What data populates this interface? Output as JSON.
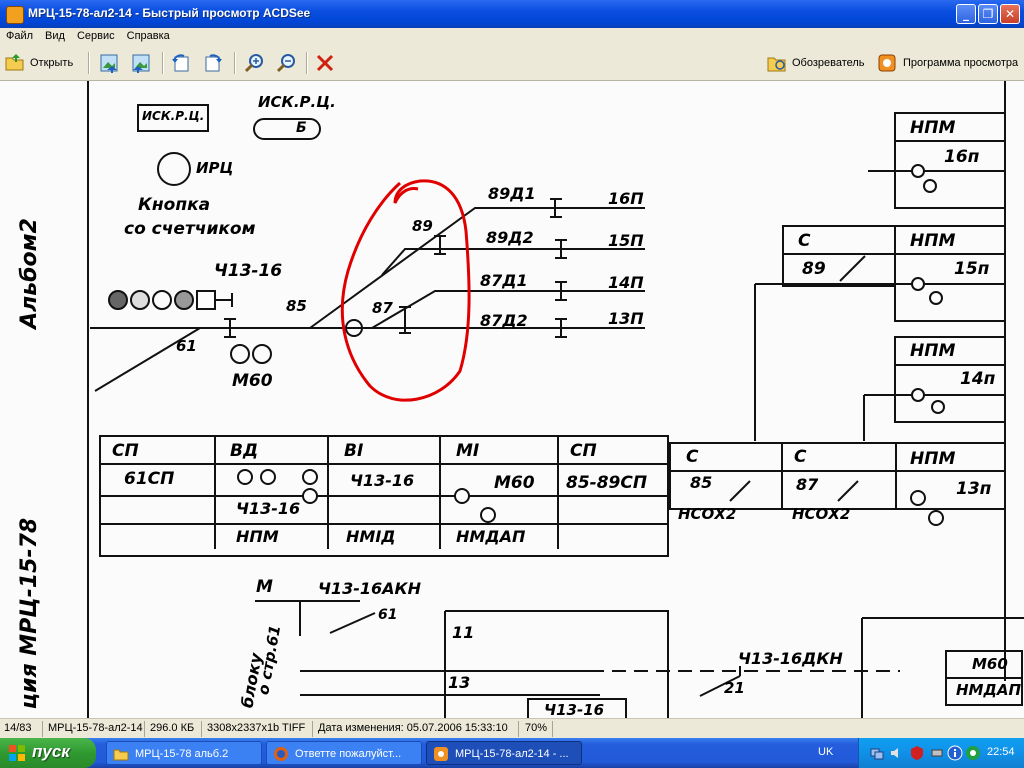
{
  "window": {
    "title": "МРЦ-15-78-ал2-14 - Быстрый просмотр ACDSee",
    "minimize": "_",
    "restore": "❐",
    "close": "✕"
  },
  "menu": [
    "Файл",
    "Вид",
    "Сервис",
    "Справка"
  ],
  "toolbar": {
    "open_label": "Открыть",
    "explorer_label": "Обозреватель",
    "viewer_label": "Программа просмотра"
  },
  "document": {
    "side_text_top": "Альбом2",
    "side_text_bottom": "ция МРЦ-15-78",
    "legend": {
      "isk_box": "ИСК.Р.Ц.",
      "isk_label": "ИСК.Р.Ц.",
      "isk_value": "Б",
      "irc": "ИРЦ",
      "knopka_1": "Кнопка",
      "knopka_2": "со счетчиком"
    },
    "track": {
      "signal_ch": "Ч13-16",
      "sw_85": "85",
      "sw_61": "61",
      "sw_89": "89",
      "sw_87": "87",
      "m60": "М60",
      "routes": [
        {
          "name": "89Д1",
          "track": "16П"
        },
        {
          "name": "89Д2",
          "track": "15П"
        },
        {
          "name": "87Д1",
          "track": "14П"
        },
        {
          "name": "87Д2",
          "track": "13П"
        }
      ]
    },
    "right_blocks": {
      "npm": "НПМ",
      "c": "С",
      "c89": "89",
      "t16": "16п",
      "t15": "15п",
      "t14": "14п",
      "t13": "13п"
    },
    "table": {
      "c1": [
        "СП",
        "61СП",
        ""
      ],
      "c2": [
        "ВД",
        "Ч13-16",
        "НПМ"
      ],
      "c3": [
        "ВI",
        "Ч13-16",
        "НМIД"
      ],
      "c4": [
        "МI",
        "М60",
        "НМДАП"
      ],
      "c5": [
        "СП",
        "85-89СП",
        ""
      ],
      "c6": [
        "С",
        "85",
        "НСОХ2"
      ],
      "c7": [
        "С",
        "87",
        "НСОХ2"
      ]
    },
    "bottom": {
      "m": "М",
      "akn": "Ч13-16АКН",
      "n61": "61",
      "n11": "11",
      "n13": "13",
      "box_ch": "Ч13-16",
      "dkn": "Ч13-16ДКН",
      "n21": "21",
      "blok_1": "блоку",
      "blok_2": "о стр.61",
      "m60": "М60",
      "nmdap": "НМДАП"
    }
  },
  "status": {
    "index": "14/83",
    "filename": "МРЦ-15-78-ал2-14",
    "size": "296.0 КБ",
    "dims": "3308x2337x1b TIFF",
    "modified": "Дата изменения: 05.07.2006 15:33:10",
    "zoom": "70%"
  },
  "taskbar": {
    "start": "пуск",
    "tasks": [
      "МРЦ-15-78 альб.2",
      "Ответте пожалуйст...",
      "МРЦ-15-78-ал2-14 - ..."
    ],
    "lang": "UK",
    "clock": "22:54"
  },
  "colors": {
    "annotation": "#e00000",
    "titlebar": "#0a4ee0",
    "taskbar": "#245edc"
  }
}
